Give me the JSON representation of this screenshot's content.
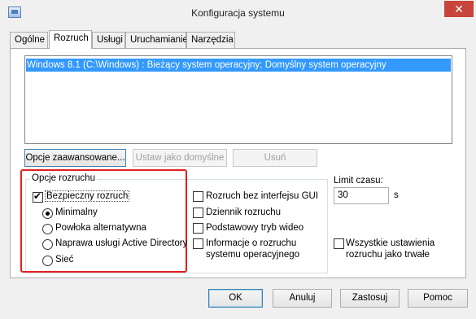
{
  "window": {
    "title": "Konfiguracja systemu",
    "close": "✕"
  },
  "tabs": [
    {
      "label": "Ogólne"
    },
    {
      "label": "Rozruch"
    },
    {
      "label": "Usługi"
    },
    {
      "label": "Uruchamianie"
    },
    {
      "label": "Narzędzia"
    }
  ],
  "active_tab": "Rozruch",
  "os_list": [
    {
      "text": "Windows 8.1 (C:\\Windows) : Bieżący system operacyjny; Domyślny system operacyjny",
      "selected": true
    }
  ],
  "buttons": {
    "advanced": "Opcje zaawansowane...",
    "set_default": "Ustaw jako domyślne",
    "delete": "Usuń"
  },
  "boot_options": {
    "title": "Opcje rozruchu",
    "safe_boot": {
      "label": "Bezpieczny rozruch",
      "checked": true
    },
    "radios": [
      {
        "label": "Minimalny",
        "checked": true
      },
      {
        "label": "Powłoka alternatywna",
        "checked": false
      },
      {
        "label": "Naprawa usługi Active Directory",
        "checked": false
      },
      {
        "label": "Sieć",
        "checked": false
      }
    ],
    "checkboxes": [
      {
        "label": "Rozruch bez interfejsu GUI",
        "checked": false
      },
      {
        "label": "Dziennik rozruchu",
        "checked": false
      },
      {
        "label": "Podstawowy tryb wideo",
        "checked": false
      },
      {
        "label_line1": "Informacje o rozruchu",
        "label_line2": "systemu operacyjnego",
        "checked": false
      }
    ]
  },
  "timeout": {
    "label": "Limit czasu:",
    "value": "30",
    "unit": "s"
  },
  "persistent": {
    "label_line1": "Wszystkie ustawienia",
    "label_line2": "rozruchu jako trwałe",
    "checked": false
  },
  "bottom_buttons": {
    "ok": "OK",
    "cancel": "Anuluj",
    "apply": "Zastosuj",
    "help": "Pomoc"
  },
  "colors": {
    "selection": "#3399ff",
    "highlight_border": "#e02020",
    "close_button": "#c7453b"
  }
}
